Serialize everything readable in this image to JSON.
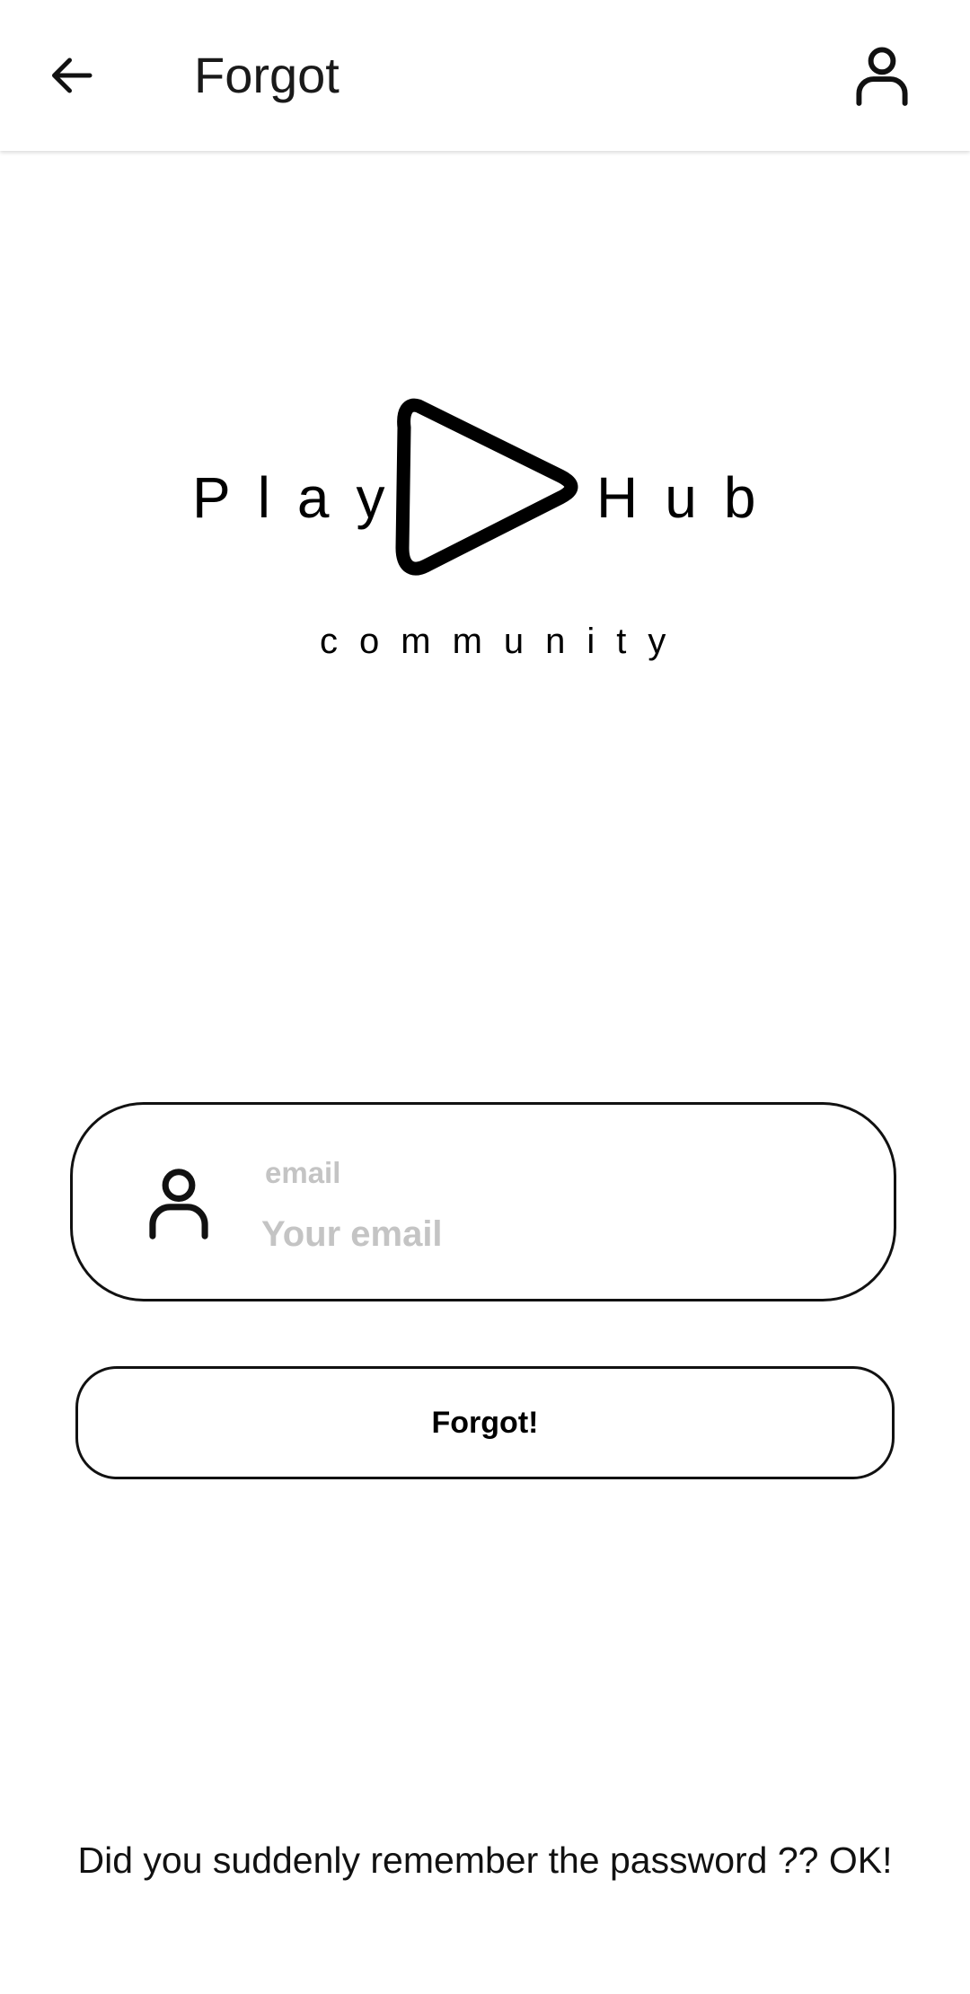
{
  "appbar": {
    "title": "Forgot",
    "back_icon": "arrow-back-icon",
    "account_icon": "person-outline-icon"
  },
  "logo": {
    "word_left": "Play",
    "word_right": "Hub",
    "tagline": "community",
    "mark_icon": "play-triangle-icon"
  },
  "form": {
    "email_label": "email",
    "email_placeholder": "Your email",
    "email_value": "",
    "email_icon": "person-outline-icon",
    "submit_label": "Forgot!"
  },
  "footer": {
    "remember_link": "Did you suddenly remember the password ?? OK!"
  },
  "colors": {
    "background": "#ffffff",
    "foreground": "#111111",
    "placeholder": "#c4c4c4",
    "border": "#111111"
  }
}
